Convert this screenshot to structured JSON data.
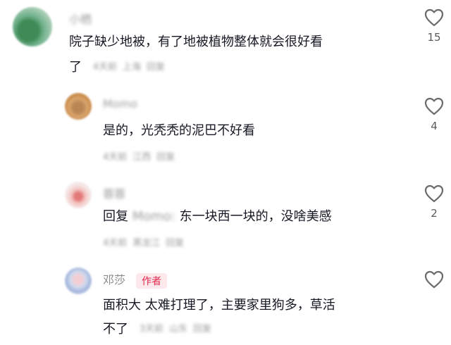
{
  "comments": [
    {
      "username": "小栖",
      "text_line1": "院子缺少地被，有了地被植物整体就会很好看",
      "text_line2": "了",
      "meta": [
        "4天前",
        "上海",
        "回复"
      ],
      "likes": "15"
    },
    {
      "username": "Momo",
      "text_line1": "是的，光秃秃的泥巴不好看",
      "meta": [
        "4天前",
        "江西",
        "回复"
      ],
      "likes": "4"
    },
    {
      "username": "蓉蓉",
      "reply_prefix": "回复",
      "reply_to": "Momo:",
      "text_line1": "东一块西一块的，没啥美感",
      "meta": [
        "4天前",
        "黑龙江",
        "回复"
      ],
      "likes": "2"
    },
    {
      "username": "邓莎",
      "badge": "作者",
      "text_line1": "面积大 太难打理了，主要家里狗多，草活",
      "text_line2": "不了",
      "meta": [
        "3天前",
        "山东",
        "回复"
      ],
      "likes": ""
    }
  ],
  "icons": {
    "like": "heart-outline-icon"
  },
  "colors": {
    "text": "#161823",
    "muted": "#9a9a9a",
    "author_badge_bg": "#fde8ec",
    "author_badge_fg": "#e0284f"
  }
}
